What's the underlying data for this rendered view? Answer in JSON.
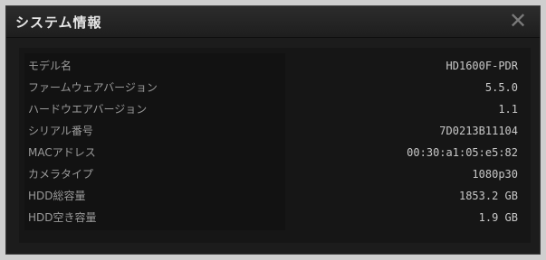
{
  "dialog": {
    "title": "システム情報",
    "close_glyph": "✕"
  },
  "info": [
    {
      "label": "モデル名",
      "value": "HD1600F-PDR"
    },
    {
      "label": "ファームウェアバージョン",
      "value": "5.5.0"
    },
    {
      "label": "ハードウエアバージョン",
      "value": "1.1"
    },
    {
      "label": "シリアル番号",
      "value": "7D0213B11104"
    },
    {
      "label": "MACアドレス",
      "value": "00:30:a1:05:e5:82"
    },
    {
      "label": "カメラタイプ",
      "value": "1080p30"
    },
    {
      "label": "HDD総容量",
      "value": "1853.2 GB"
    },
    {
      "label": "HDD空き容量",
      "value": "1.9 GB"
    }
  ]
}
